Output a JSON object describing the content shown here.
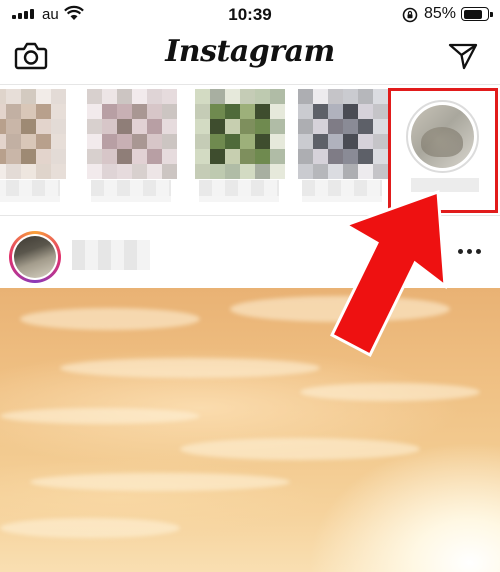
{
  "status_bar": {
    "carrier": "au",
    "time": "10:39",
    "battery_percent_text": "85%",
    "battery_level": 0.85
  },
  "header": {
    "logo": "Instagram",
    "left_icon": "camera-icon",
    "right_icon": "send-icon"
  },
  "stories": {
    "items": [
      {
        "colors": [
          "#d9c7b8",
          "#b8a08c",
          "#c9b6a8",
          "#9e8a74",
          "#e3d4cc",
          "#c2b0a3"
        ]
      },
      {
        "colors": [
          "#c8b0b4",
          "#a99793",
          "#d7c6c8",
          "#8f7e78",
          "#e2d1d4",
          "#b89fa4"
        ]
      },
      {
        "colors": [
          "#6f8a4f",
          "#4f6a3a",
          "#9db07a",
          "#3e4d2e",
          "#c7cfb0",
          "#7e8f5d"
        ]
      },
      {
        "colors": [
          "#8a8b96",
          "#5d6068",
          "#b0b2bd",
          "#4a4c54",
          "#d6d2da",
          "#7f7c86"
        ]
      }
    ],
    "own_icon": "profile-avatar-icon"
  },
  "post": {
    "more_icon": "more-horizontal-icon"
  },
  "colors": {
    "highlight": "#e11b1b",
    "arrow": "#ee1111"
  }
}
